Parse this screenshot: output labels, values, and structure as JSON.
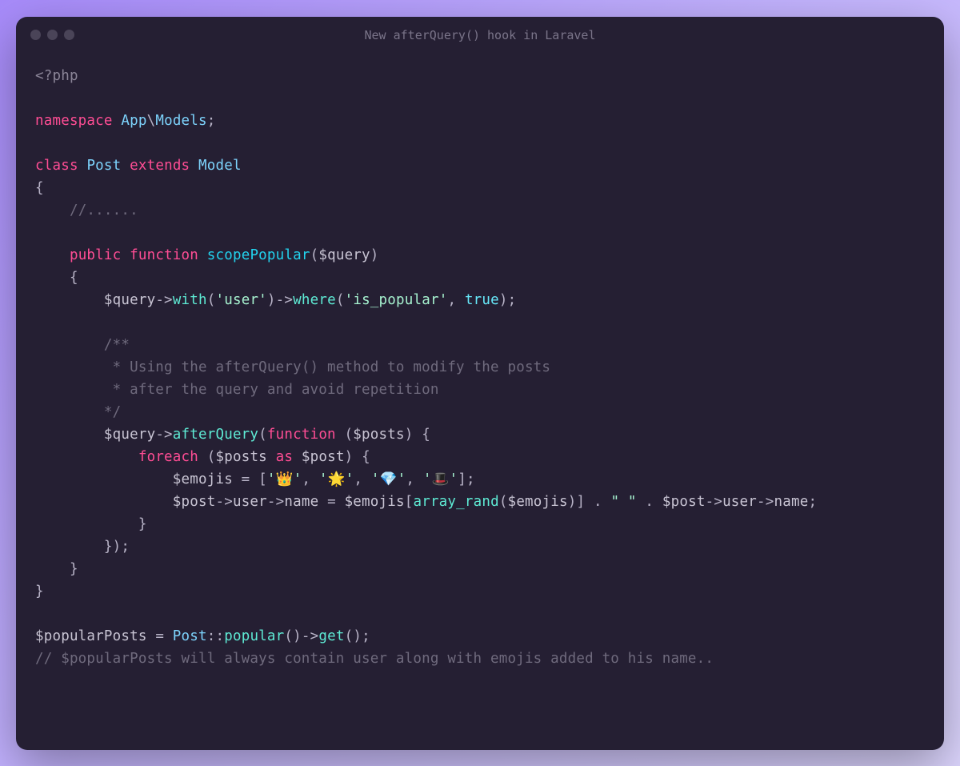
{
  "window": {
    "title": "New afterQuery() hook in Laravel"
  },
  "code": {
    "line1_tag": "<?php",
    "line2_namespace": "namespace",
    "line2_app": "App",
    "line2_bs": "\\",
    "line2_models": "Models",
    "line2_semi": ";",
    "line3_class": "class",
    "line3_post": "Post",
    "line3_extends": "extends",
    "line3_model": "Model",
    "brace_open": "{",
    "brace_close": "}",
    "comment_dots": "//......",
    "fn_public": "public",
    "fn_function": "function",
    "fn_name": "scopePopular",
    "fn_paren_open": "(",
    "fn_query": "$query",
    "fn_paren_close": ")",
    "arrow": "->",
    "with": "with",
    "str_user": "'user'",
    "where": "where",
    "str_is_popular": "'is_popular'",
    "comma": ",",
    "true": "true",
    "semi": ";",
    "doc1": "/**",
    "doc2": " * Using the afterQuery() method to modify the posts",
    "doc3": " * after the query and avoid repetition",
    "doc4": "*/",
    "afterQuery": "afterQuery",
    "function_kw": "function",
    "posts": "$posts",
    "foreach": "foreach",
    "as": "as",
    "post": "$post",
    "emojis": "$emojis",
    "eq": " = ",
    "arr_open": "[",
    "e1": "'👑'",
    "e2": "'🌟'",
    "e3": "'💎'",
    "e4": "'🎩'",
    "arr_close": "]",
    "user_prop": "user",
    "name_prop": "name",
    "array_rand": "array_rand",
    "dot": " . ",
    "space_str": "\" \"",
    "close_paren_semi": ");",
    "popularPosts": "$popularPosts",
    "Post": "Post",
    "dcolon": "::",
    "popular": "popular",
    "get": "get",
    "empty_parens": "()",
    "final_comment": "// $popularPosts will always contain user along with emojis added to his name.."
  }
}
